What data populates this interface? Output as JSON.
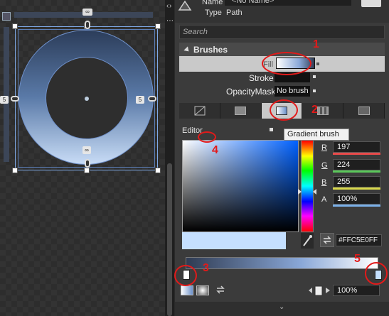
{
  "artboard": {
    "dimensions": {
      "top": "∞",
      "bottom": "∞",
      "left": "5",
      "right": "5"
    }
  },
  "panel": {
    "name_label": "Name",
    "name_value": "<No Name>",
    "type_label": "Type",
    "type_value": "Path",
    "search_placeholder": "Search",
    "section_title": "Brushes",
    "fill_label": "Fill",
    "stroke_label": "Stroke",
    "opacitymask_label": "OpacityMask",
    "opacitymask_value": "No brush",
    "tabs": [
      "No brush",
      "Solid color brush",
      "Gradient brush",
      "Tile brush",
      "Brush resources"
    ],
    "editor_label": "Editor",
    "tooltip": "Gradient brush",
    "channels": [
      {
        "label": "R",
        "value": "197",
        "bar": "#e84a4a"
      },
      {
        "label": "G",
        "value": "224",
        "bar": "#5ac85a"
      },
      {
        "label": "B",
        "value": "255",
        "bar": "#d8d84a"
      },
      {
        "label": "A",
        "value": "100%",
        "bar": "#7ab0e8"
      }
    ],
    "hex_value": "#FFC5E0FF",
    "stop_offset": "100%",
    "colors": {
      "preview": "#C5E0FF",
      "annotation": "#e21a1a"
    }
  },
  "annotations": [
    "1",
    "2",
    "3",
    "4",
    "5"
  ]
}
